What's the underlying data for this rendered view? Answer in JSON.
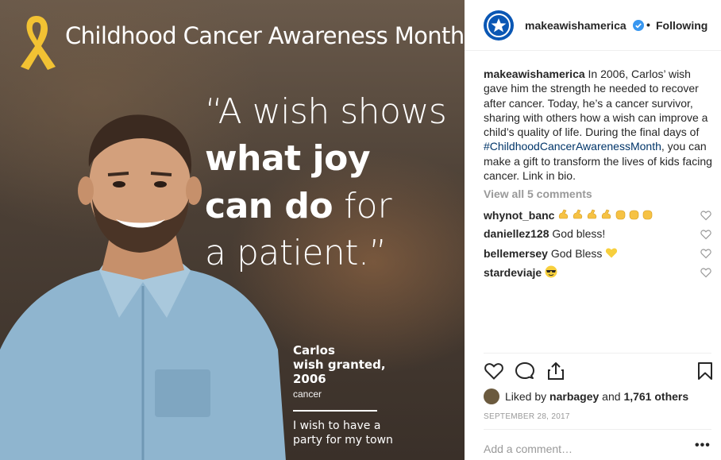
{
  "post_image": {
    "banner_title": "Childhood Cancer Awareness Month",
    "quote": {
      "line1": "“A wish shows",
      "line2": "what joy",
      "line3_bold": "can do",
      "line3_rest": " for",
      "line4": "a patient.”"
    },
    "caption": {
      "name": "Carlos",
      "granted": "wish granted,",
      "year": "2006",
      "diagnosis": "cancer",
      "wish_line1": "I wish to have a",
      "wish_line2": "party for my town"
    }
  },
  "header": {
    "username": "makeawishamerica",
    "separator": "•",
    "follow_label": "Following"
  },
  "post_caption": {
    "username": "makeawishamerica",
    "text_before": " In 2006, Carlos’ wish gave him the strength he needed to recover after cancer. Today, he’s a cancer survivor, sharing with others how a wish can improve a child’s quality of life. During the final days of ",
    "hashtag": "#ChildhoodCancerAwarenessMonth",
    "text_after": ", you can make a gift to transform the lives of kids facing cancer. Link in bio."
  },
  "view_all_label": "View all 5 comments",
  "comments": [
    {
      "username": "whynot_banc",
      "text": " "
    },
    {
      "username": "daniellez128",
      "text": " God bless!"
    },
    {
      "username": "bellemersey",
      "text": " God Bless "
    },
    {
      "username": "stardeviaje",
      "text": " "
    }
  ],
  "likes": {
    "prefix": "Liked by ",
    "user": "narbagey",
    "middle": " and ",
    "count": "1,761 others"
  },
  "date": "SEPTEMBER 28, 2017",
  "add_comment_placeholder": "Add a comment…",
  "more_label": "•••",
  "colors": {
    "ribbon": "#f2c233",
    "verified": "#3897f0",
    "hashtag": "#003569",
    "avatar_blue": "#0a57b4"
  }
}
